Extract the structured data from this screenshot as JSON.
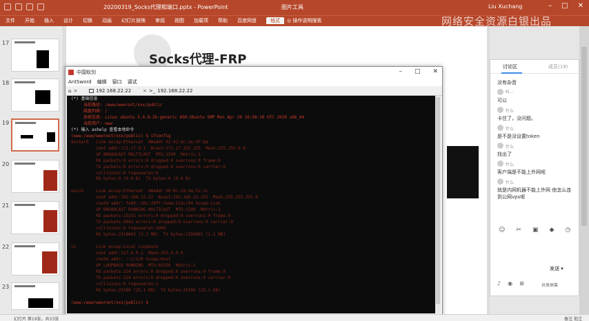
{
  "window": {
    "doc_title": "20200319_Socks代理和端口.pptx - PowerPoint",
    "context_tab": "图片工具",
    "user": "Liu Xuchang"
  },
  "ribbon": {
    "tabs": [
      "文件",
      "开始",
      "插入",
      "设计",
      "切换",
      "动画",
      "幻灯片放映",
      "审阅",
      "视图",
      "加载项",
      "帮助",
      "百度网盘",
      "格式"
    ],
    "tell_me": "操作说明搜索"
  },
  "watermark": "网络安全资源白银出品",
  "thumbnails": {
    "numbers": [
      "17",
      "18",
      "19",
      "20",
      "21",
      "22",
      "23"
    ],
    "selected": "19"
  },
  "slide": {
    "title": "Socks代理-FRP"
  },
  "terminal_window": {
    "title": "中国蚁剑",
    "menu": [
      "AntSword",
      "编辑",
      "窗口",
      "调试"
    ],
    "tab_address_1": "192.168.22.22",
    "tab_address_2": "192.168.22.22",
    "lines": [
      {
        "t": "(*) 基础信息",
        "c": "c-w"
      },
      {
        "t": "     当前路径: /www/wwwroot/xxx/public",
        "c": "c-r"
      },
      {
        "t": "     磁盘列表: /",
        "c": "c-r"
      },
      {
        "t": "     系统信息: Linux ubuntu 5.4.0-26-generic #30-Ubuntu SMP Mon Apr 20 16:58:30 UTC 2020 x86_64",
        "c": "c-r"
      },
      {
        "t": "     当前用户: www",
        "c": "c-r"
      },
      {
        "t": "(*) 输入 ashelp 查看本地命令",
        "c": "c-w"
      },
      {
        "t": "(www:/www/wwwroot/xxx/public) $ ifconfig",
        "c": "c-r"
      },
      {
        "t": "docker0   Link encap:Ethernet  HWaddr 02:42:dc:2e:4f:8a",
        "c": "c-dr"
      },
      {
        "t": "          inet addr:172.17.0.1  Bcast:172.17.255.255  Mask:255.255.0.0",
        "c": "c-dr"
      },
      {
        "t": "          UP BROADCAST MULTICAST  MTU:1500  Metric:1",
        "c": "c-dr"
      },
      {
        "t": "          RX packets:0 errors:0 dropped:0 overruns:0 frame:0",
        "c": "c-dr"
      },
      {
        "t": "          TX packets:0 errors:0 dropped:0 overruns:0 carrier:0",
        "c": "c-dr"
      },
      {
        "t": "          collisions:0 txqueuelen:0",
        "c": "c-dr"
      },
      {
        "t": "          RX bytes:0 (0.0 B)  TX bytes:0 (0.0 B)",
        "c": "c-dr"
      },
      {
        "t": "",
        "c": "c-dr"
      },
      {
        "t": "ens33     Link encap:Ethernet  HWaddr 00:0c:29:4a:51:2c",
        "c": "c-dr"
      },
      {
        "t": "          inet addr:192.168.22.22  Bcast:192.168.22.255  Mask:255.255.255.0",
        "c": "c-dr"
      },
      {
        "t": "          inet6 addr: fe80::20c:29ff:fe4a:512c/64 Scope:Link",
        "c": "c-dr"
      },
      {
        "t": "          UP BROADCAST RUNNING MULTICAST  MTU:1500  Metric:1",
        "c": "c-dr"
      },
      {
        "t": "          RX packets:15231 errors:0 dropped:0 overruns:0 frame:0",
        "c": "c-dr"
      },
      {
        "t": "          TX packets:9842 errors:0 dropped:0 overruns:0 carrier:0",
        "c": "c-dr"
      },
      {
        "t": "          collisions:0 txqueuelen:1000",
        "c": "c-dr"
      },
      {
        "t": "          RX bytes:2318842 (2.3 MB)  TX bytes:1294801 (1.2 MB)",
        "c": "c-dr"
      },
      {
        "t": "",
        "c": "c-dr"
      },
      {
        "t": "lo        Link encap:Local Loopback",
        "c": "c-dr"
      },
      {
        "t": "          inet addr:127.0.0.1  Mask:255.0.0.0",
        "c": "c-dr"
      },
      {
        "t": "          inet6 addr: ::1/128 Scope:Host",
        "c": "c-dr"
      },
      {
        "t": "          UP LOOPBACK RUNNING  MTU:65536  Metric:1",
        "c": "c-dr"
      },
      {
        "t": "          RX packets:324 errors:0 dropped:0 overruns:0 frame:0",
        "c": "c-dr"
      },
      {
        "t": "          TX packets:324 errors:0 dropped:0 overruns:0 carrier:0",
        "c": "c-dr"
      },
      {
        "t": "          collisions:0 txqueuelen:1",
        "c": "c-dr"
      },
      {
        "t": "          RX bytes:25180 (25.1 KB)  TX bytes:25180 (25.1 KB)",
        "c": "c-dr"
      },
      {
        "t": "",
        "c": "c-dr"
      },
      {
        "t": "(www:/www/wwwroot/xxx/public) $",
        "c": "c-r"
      }
    ]
  },
  "discussion": {
    "tab_active": "讨论区",
    "tab_inactive": "成员(19)",
    "messages": [
      {
        "kind": "text",
        "t": "没有杂音"
      },
      {
        "kind": "name",
        "t": "Ki..."
      },
      {
        "kind": "text",
        "t": "可以"
      },
      {
        "kind": "name",
        "t": "什么"
      },
      {
        "kind": "text",
        "t": "卡住了，没问题。"
      },
      {
        "kind": "name",
        "t": "什么"
      },
      {
        "kind": "text",
        "t": "是不是没设置token"
      },
      {
        "kind": "name",
        "t": "什么"
      },
      {
        "kind": "text",
        "t": "找出了"
      },
      {
        "kind": "name",
        "t": "什么"
      },
      {
        "kind": "text",
        "t": "客户端是不能上外网呢"
      },
      {
        "kind": "name",
        "t": "什么"
      },
      {
        "kind": "text",
        "t": "就是内网机器不能上外网 他怎么连到公网vps呢"
      }
    ],
    "send_label": "发送",
    "shared_label": "共享屏幕"
  },
  "status": {
    "left": "幻灯片 第19张，共33张",
    "right": "备注   批注"
  }
}
